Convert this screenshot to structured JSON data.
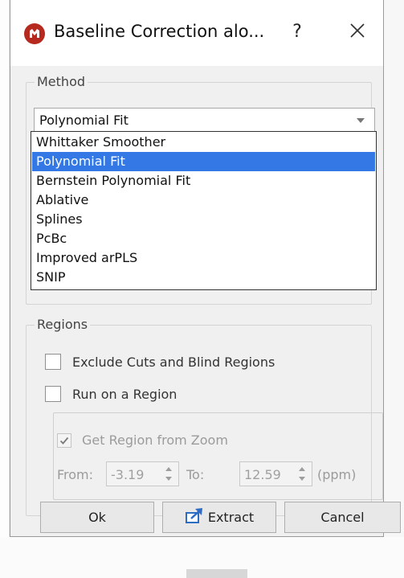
{
  "window": {
    "title": "Baseline Correction alo...",
    "help_label": "?",
    "close_icon": "close-icon",
    "app_icon": "mestrenova-logo-icon",
    "accent": "#b5291e"
  },
  "method": {
    "title": "Method",
    "selected": "Polynomial Fit",
    "options": [
      "Whittaker Smoother",
      "Polynomial Fit",
      "Bernstein Polynomial Fit",
      "Ablative",
      "Splines",
      "PcBc",
      "Improved arPLS",
      "SNIP"
    ]
  },
  "regions": {
    "title": "Regions",
    "exclude_cuts_label": "Exclude Cuts and Blind Regions",
    "exclude_cuts_checked": false,
    "run_on_region_label": "Run on a Region",
    "run_on_region_checked": false,
    "get_region_from_zoom_label": "Get Region from Zoom",
    "get_region_from_zoom_checked": true,
    "from_label": "From:",
    "from_value": "-3.19",
    "to_label": "To:",
    "to_value": "12.59",
    "unit_label": "(ppm)"
  },
  "buttons": {
    "ok": "Ok",
    "extract": "Extract",
    "cancel": "Cancel"
  },
  "colors": {
    "selection": "#3478e6",
    "disabled_text": "#9b9b9b"
  }
}
